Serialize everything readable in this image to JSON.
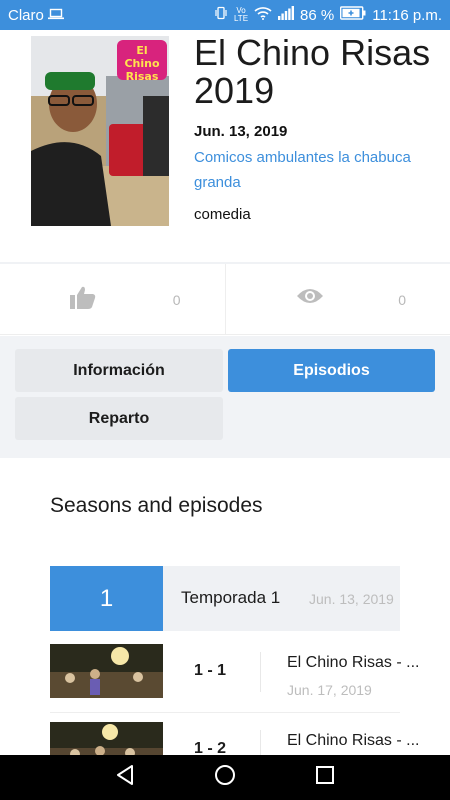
{
  "status_bar": {
    "carrier": "Claro",
    "volte_top": "Vo",
    "volte_bottom": "LTE",
    "battery": "86 %",
    "time": "11:16 p.m."
  },
  "show": {
    "title": "El Chino Risas 2019",
    "date": "Jun. 13, 2019",
    "venue": "Comicos ambulantes la chabuca granda",
    "genre": "comedia",
    "poster_logo": "El Chino Risas"
  },
  "stats": {
    "likes": "0",
    "views": "0"
  },
  "tabs": {
    "info": "Información",
    "episodes": "Episodios",
    "cast": "Reparto"
  },
  "seasons": {
    "heading": "Seasons and episodes",
    "season_number": "1",
    "season_label": "Temporada 1",
    "season_date": "Jun. 13, 2019"
  },
  "episodes": [
    {
      "number": "1 - 1",
      "title": "El Chino Risas - ...",
      "date": "Jun. 17, 2019"
    },
    {
      "number": "1 - 2",
      "title": "El Chino Risas - ...",
      "date": ""
    }
  ],
  "colors": {
    "accent": "#3d8fdc",
    "status_bar": "#3d8fdc"
  },
  "icons": [
    "laptop-icon",
    "vibrate-icon",
    "wifi-icon",
    "signal-icon",
    "battery-icon",
    "thumbs-up-icon",
    "eye-icon",
    "back-icon",
    "home-icon",
    "recents-icon"
  ]
}
